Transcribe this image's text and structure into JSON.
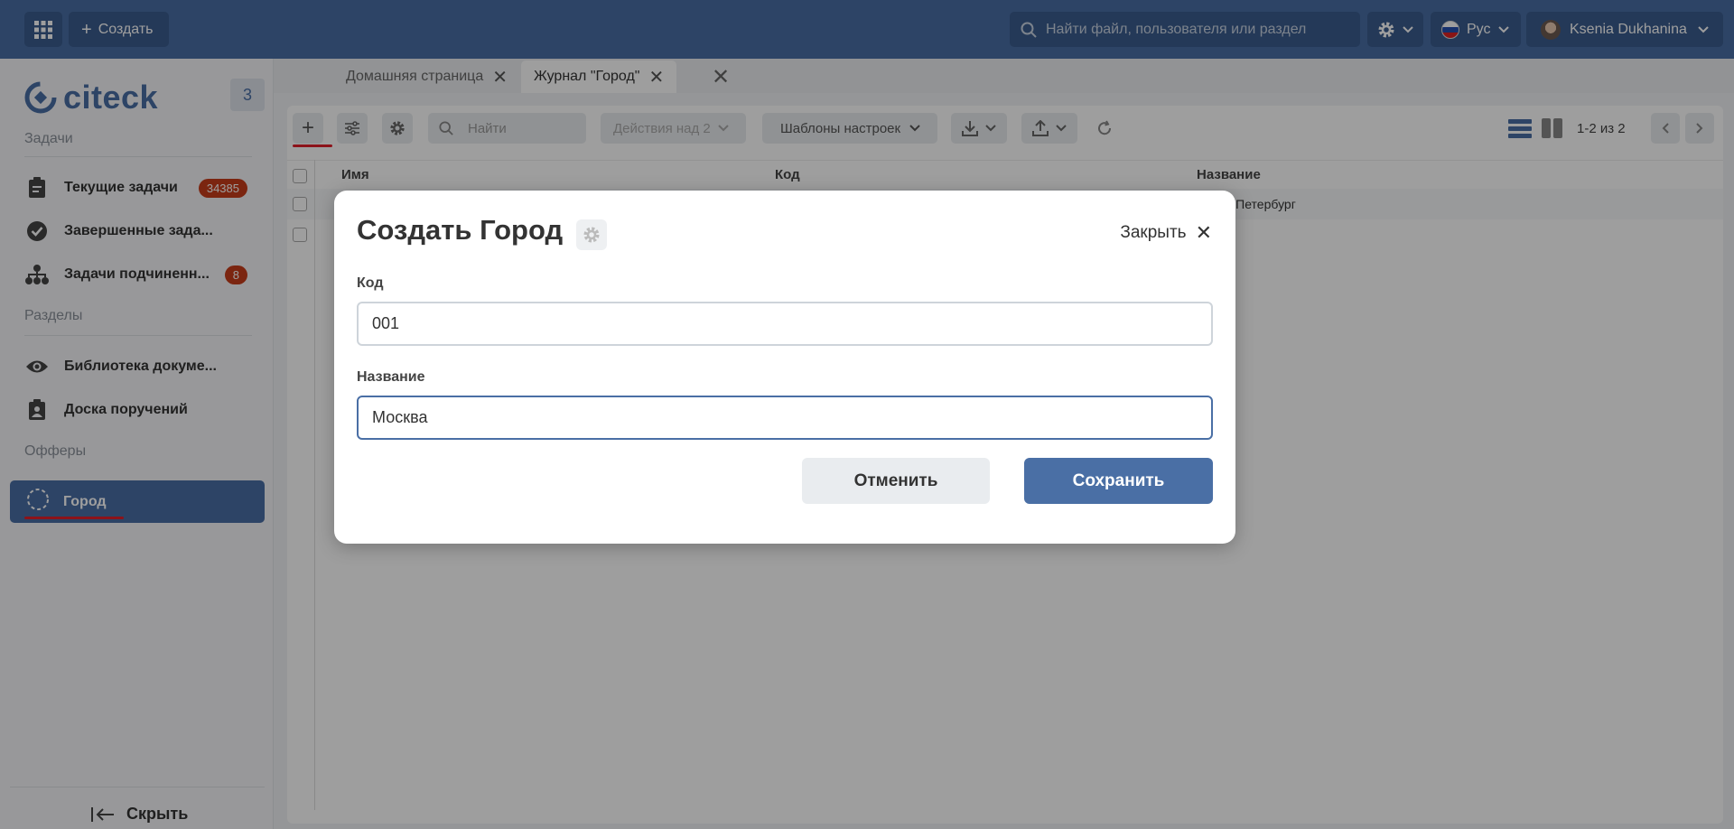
{
  "topbar": {
    "create_label": "Создать",
    "search_placeholder": "Найти файл, пользователя или раздел",
    "language": "Рус",
    "user_name": "Ksenia Dukhanina"
  },
  "sidebar": {
    "logo_text": "citeck",
    "counter": "3",
    "sections": {
      "tasks": "Задачи",
      "sections": "Разделы",
      "offers": "Офферы"
    },
    "items": [
      {
        "label": "Текущие задачи",
        "badge": "34385",
        "icon": "clipboard-icon"
      },
      {
        "label": "Завершенные зада...",
        "icon": "check-circle-icon"
      },
      {
        "label": "Задачи подчиненн...",
        "badge": "8",
        "icon": "hierarchy-icon"
      },
      {
        "label": "Библиотека докуме...",
        "icon": "eye-icon"
      },
      {
        "label": "Доска поручений",
        "icon": "clipboard-person-icon"
      }
    ],
    "active_item": {
      "label": "Город",
      "icon": "dashed-circle-icon"
    },
    "hide_label": "Скрыть"
  },
  "tabs": [
    {
      "label": "Домашняя страница"
    },
    {
      "label": "Журнал \"Город\""
    }
  ],
  "toolbar": {
    "search_placeholder": "Найти",
    "actions_label": "Действия над 2",
    "templates_label": "Шаблоны настроек",
    "pagination": "1-2 из 2"
  },
  "table": {
    "columns": [
      "Имя",
      "Код",
      "Название"
    ],
    "rows": [
      {
        "name": "",
        "code": "",
        "title": "Санкт-Петербург"
      },
      {
        "name": "",
        "code": "",
        "title": ""
      }
    ]
  },
  "modal": {
    "title": "Создать Город",
    "close_label": "Закрыть",
    "fields": {
      "code_label": "Код",
      "code_value": "001",
      "name_label": "Название",
      "name_value": "Москва"
    },
    "cancel_label": "Отменить",
    "save_label": "Сохранить"
  },
  "colors": {
    "accent": "#4a6fa5",
    "badge": "#c73c1a",
    "highlight_underline": "#e3202a"
  }
}
